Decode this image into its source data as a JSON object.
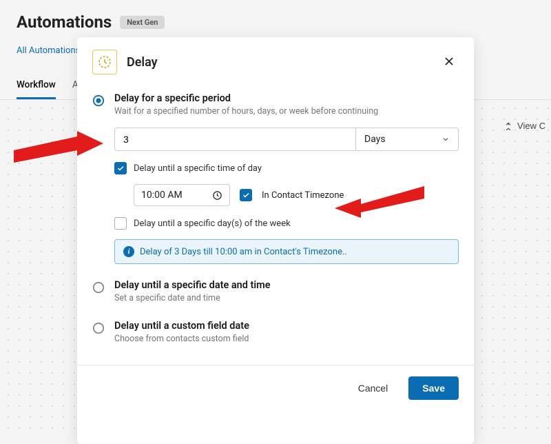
{
  "page": {
    "title": "Automations",
    "badge": "Next Gen",
    "breadcrumb": "All Automations",
    "tabs": [
      "Workflow",
      "A"
    ],
    "view_button": "View C"
  },
  "modal": {
    "title": "Delay",
    "options": {
      "specific_period": {
        "title": "Delay for a specific period",
        "subtitle": "Wait for a specified number of hours, days, or week before continuing",
        "value": "3",
        "unit": "Days",
        "delay_until_time": {
          "label": "Delay until a specific time of day",
          "time_value": "10:00  AM",
          "in_contact_tz_label": "In Contact Timezone"
        },
        "delay_until_dow": {
          "label": "Delay until a specific day(s) of the week"
        },
        "info_text": "Delay of 3 Days till 10:00 am in Contact's Timezone.."
      },
      "specific_datetime": {
        "title": "Delay until a specific date and time",
        "subtitle": "Set a specific date and time"
      },
      "custom_field": {
        "title": "Delay until a custom field date",
        "subtitle": "Choose from contacts custom field"
      }
    },
    "buttons": {
      "cancel": "Cancel",
      "save": "Save"
    }
  }
}
